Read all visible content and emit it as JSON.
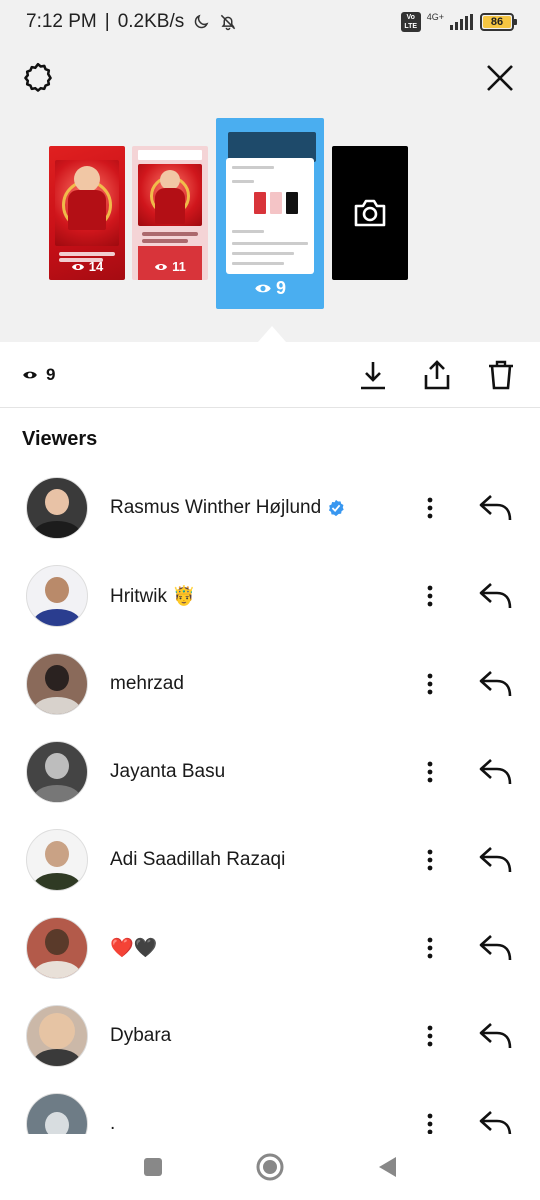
{
  "status_bar": {
    "time": "7:12 PM",
    "separator": "|",
    "speed": "0.2KB/s",
    "volte": "Vo LTE",
    "network": "4G+",
    "battery": "86"
  },
  "top_bar": {
    "settings_icon": "gear-icon",
    "close_icon": "close-icon"
  },
  "stories": [
    {
      "views": "14",
      "selected": false
    },
    {
      "views": "11",
      "selected": false
    },
    {
      "views": "9",
      "selected": true
    },
    {
      "type": "camera",
      "icon": "camera-icon"
    }
  ],
  "actions": {
    "view_count": "9",
    "download_icon": "download-icon",
    "share_icon": "share-icon",
    "delete_icon": "trash-icon"
  },
  "viewers": {
    "title": "Viewers",
    "items": [
      {
        "name": "Rasmus Winther Højlund",
        "verified": true,
        "avatar_color": "#3a3a3a"
      },
      {
        "name": "Hritwik 🤴",
        "verified": false,
        "avatar_color": "#6b7fbf"
      },
      {
        "name": "mehrzad",
        "verified": false,
        "avatar_color": "#8a6a5a"
      },
      {
        "name": "Jayanta Basu",
        "verified": false,
        "avatar_color": "#444444"
      },
      {
        "name": "Adi Saadillah Razaqi",
        "verified": false,
        "avatar_color": "#f4f4f4"
      },
      {
        "name": "❤️🖤",
        "verified": false,
        "avatar_color": "#b35a4a"
      },
      {
        "name": "Dybara",
        "verified": false,
        "avatar_color": "#cbb8a8"
      },
      {
        "name": ".",
        "verified": false,
        "avatar_color": "#6e7c86"
      }
    ]
  },
  "nav": {
    "recents_icon": "square-icon",
    "home_icon": "circle-home-icon",
    "back_icon": "back-triangle-icon"
  }
}
